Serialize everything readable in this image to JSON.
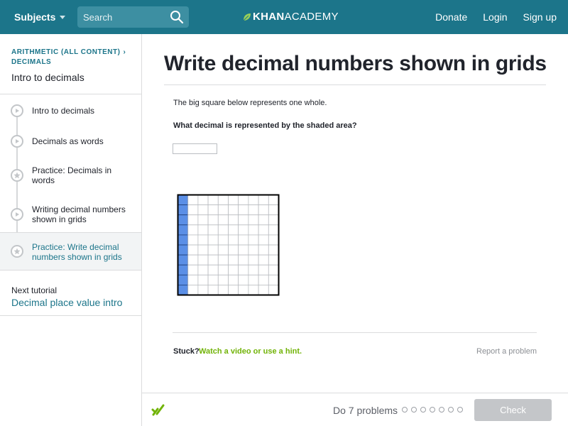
{
  "nav": {
    "subjects_label": "Subjects",
    "search_placeholder": "Search",
    "logo_khan": "KHAN",
    "logo_academy": "ACADEMY",
    "donate_label": "Donate",
    "login_label": "Login",
    "signup_label": "Sign up"
  },
  "colors": {
    "brand": "#1c758a",
    "grid_shade": "#5b8fe6",
    "hint_green": "#71b307",
    "active_bg": "#f2f4f5"
  },
  "sidebar": {
    "breadcrumb_line1": "ARITHMETIC (ALL CONTENT)",
    "breadcrumb_sep": "›",
    "breadcrumb_line2": "DECIMALS",
    "tutorial_title": "Intro to decimals",
    "items": [
      {
        "label": "Intro to decimals",
        "icon": "play-icon",
        "active": false
      },
      {
        "label": "Decimals as words",
        "icon": "play-icon",
        "active": false
      },
      {
        "label": "Practice: Decimals in words",
        "icon": "star-icon",
        "active": false
      },
      {
        "label": "Writing decimal numbers shown in grids",
        "icon": "play-icon",
        "active": false
      },
      {
        "label": "Practice: Write decimal numbers shown in grids",
        "icon": "star-icon",
        "active": true
      }
    ],
    "next_tutorial_label": "Next tutorial",
    "next_tutorial_link": "Decimal place value intro"
  },
  "main": {
    "title": "Write decimal numbers shown in grids",
    "prompt_line": "The big square below represents one whole.",
    "question": "What decimal is represented by the shaded area?",
    "answer_value": "",
    "grid": {
      "rows": 10,
      "cols": 10,
      "shaded_columns": 1
    },
    "stuck_label": "Stuck?",
    "hint_link": "Watch a video or use a hint.",
    "report_link": "Report a problem"
  },
  "footer": {
    "do_problems": "Do 7 problems",
    "problem_count": 7,
    "completed": 0,
    "check_label": "Check"
  }
}
